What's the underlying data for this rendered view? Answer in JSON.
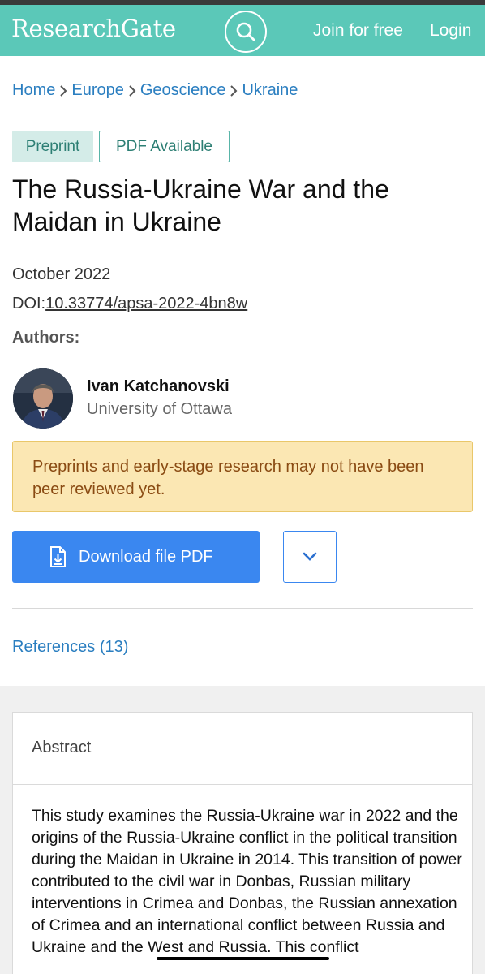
{
  "header": {
    "logo": "ResearchGate",
    "join": "Join for free",
    "login": "Login",
    "search_icon": "search-icon"
  },
  "breadcrumb": {
    "items": [
      "Home",
      "Europe",
      "Geoscience",
      "Ukraine"
    ]
  },
  "badges": {
    "preprint": "Preprint",
    "pdf": "PDF Available"
  },
  "publication": {
    "title": "The Russia-Ukraine War and the Maidan in Ukraine",
    "date": "October 2022",
    "doi_label": "DOI:",
    "doi": "10.33774/apsa-2022-4bn8w"
  },
  "authors": {
    "label": "Authors:",
    "list": [
      {
        "name": "Ivan Katchanovski",
        "affiliation": "University of Ottawa"
      }
    ]
  },
  "notice": {
    "text": "Preprints and early-stage research may not have been peer reviewed yet."
  },
  "actions": {
    "download": "Download file PDF",
    "more_icon": "chevron-down-icon"
  },
  "references": {
    "label": "References (13)"
  },
  "abstract": {
    "heading": "Abstract",
    "text": "This study examines the Russia-Ukraine war in 2022 and the origins of the Russia-Ukraine conflict in the political transition during the Maidan in Ukraine in 2014. This transition of power contributed to the civil war in Donbas, Russian military interventions in Crimea and Donbas, the Russian annexation of Crimea and an international conflict between Russia and Ukraine and the West and Russia. This conflict"
  },
  "colors": {
    "brand": "#5bc8b8",
    "link": "#2a7ec0",
    "primary_button": "#3a87f0",
    "warning_bg": "#fbe7b3",
    "warning_text": "#8a4b13"
  }
}
